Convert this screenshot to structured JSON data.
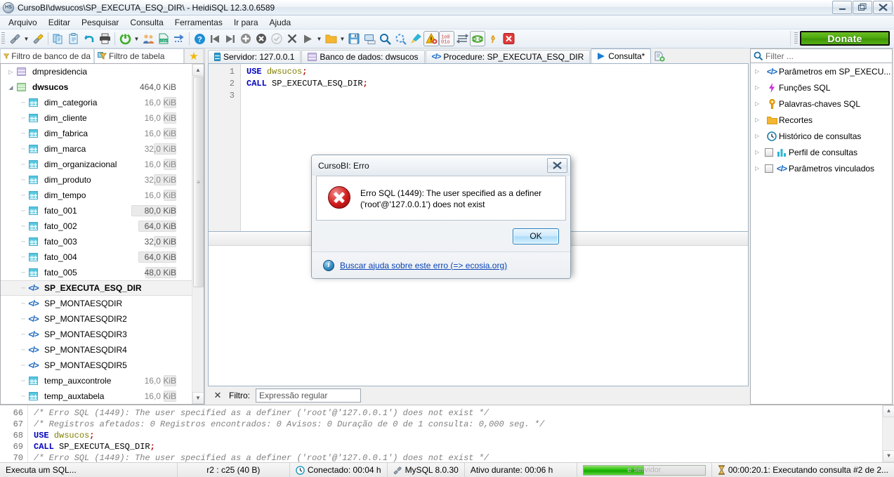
{
  "window": {
    "title": "CursoBI\\dwsucos\\SP_EXECUTA_ESQ_DIR\\ - HeidiSQL 12.3.0.6589",
    "app_icon_text": "HS",
    "minimize_label": "—",
    "maximize_label": "❐",
    "close_label": "✕"
  },
  "menubar": {
    "items": [
      {
        "label": "Arquivo"
      },
      {
        "label": "Editar"
      },
      {
        "label": "Pesquisar"
      },
      {
        "label": "Consulta"
      },
      {
        "label": "Ferramentas"
      },
      {
        "label": "Ir para"
      },
      {
        "label": "Ajuda"
      }
    ]
  },
  "toolbar": {
    "donate_label": "Donate",
    "buttons": [
      {
        "name": "new-session-icon",
        "glyph": "🔌"
      },
      {
        "name": "new-session-dropdown-icon",
        "glyph": "▾"
      },
      {
        "name": "new-session-edit-icon",
        "glyph": "🔌"
      },
      {
        "name": "copy-icon",
        "glyph": "📋"
      },
      {
        "name": "paste-icon",
        "glyph": "📋"
      },
      {
        "name": "undo-icon",
        "glyph": "↶"
      },
      {
        "name": "print-icon",
        "glyph": "🖨"
      },
      {
        "name": "refresh-icon",
        "glyph": "⟳"
      },
      {
        "name": "refresh-dropdown-icon",
        "glyph": "▾"
      },
      {
        "name": "users-icon",
        "glyph": "👥"
      },
      {
        "name": "export-csv-icon",
        "glyph": "CSV"
      },
      {
        "name": "import-icon",
        "glyph": "⇥"
      },
      {
        "name": "help-icon",
        "glyph": "?"
      },
      {
        "name": "first-row-icon",
        "glyph": "⏮"
      },
      {
        "name": "last-row-icon",
        "glyph": "⏭"
      },
      {
        "name": "insert-row-icon",
        "glyph": "+"
      },
      {
        "name": "delete-row-icon",
        "glyph": "✕"
      },
      {
        "name": "apply-changes-icon",
        "glyph": "✓"
      },
      {
        "name": "cancel-changes-icon",
        "glyph": "✕"
      },
      {
        "name": "run-query-icon",
        "glyph": "▶"
      },
      {
        "name": "run-query-dropdown-icon",
        "glyph": "▾"
      },
      {
        "name": "open-file-icon",
        "glyph": "📁"
      },
      {
        "name": "open-file-dropdown-icon",
        "glyph": "▾"
      },
      {
        "name": "save-file-icon",
        "glyph": "💾"
      },
      {
        "name": "save-as-icon",
        "glyph": "🖫"
      },
      {
        "name": "find-icon",
        "glyph": "🔍"
      },
      {
        "name": "find-replace-icon",
        "glyph": "⟳"
      },
      {
        "name": "format-sql-icon",
        "glyph": "🖌"
      },
      {
        "name": "warning-icon",
        "glyph": "⚠"
      },
      {
        "name": "binary-icon",
        "glyph": "100"
      },
      {
        "name": "wrap-lines-icon",
        "glyph": "⇶"
      },
      {
        "name": "refresh-pair-icon",
        "glyph": "↔"
      },
      {
        "name": "delimiter-icon",
        "glyph": ";"
      },
      {
        "name": "stop-icon",
        "glyph": "✕"
      }
    ]
  },
  "sidebar": {
    "db_filter_placeholder": "Filtro de banco de da",
    "table_filter_placeholder": "Filtro de tabela",
    "favorites_icon": "★",
    "tree": [
      {
        "name": "dmpresidencia",
        "type": "database",
        "size": "",
        "expander": "▷",
        "bold": false,
        "active": false
      },
      {
        "name": "dwsucos",
        "type": "database",
        "size": "464,0 KiB",
        "expander": "◢",
        "bold": true,
        "active": true
      },
      {
        "name": "dim_categoria",
        "type": "table",
        "size": "16,0 KiB",
        "bar": 18
      },
      {
        "name": "dim_cliente",
        "type": "table",
        "size": "16,0 KiB",
        "bar": 18
      },
      {
        "name": "dim_fabrica",
        "type": "table",
        "size": "16,0 KiB",
        "bar": 18
      },
      {
        "name": "dim_marca",
        "type": "table",
        "size": "32,0 KiB",
        "bar": 32
      },
      {
        "name": "dim_organizacional",
        "type": "table",
        "size": "16,0 KiB",
        "bar": 18
      },
      {
        "name": "dim_produto",
        "type": "table",
        "size": "32,0 KiB",
        "bar": 32
      },
      {
        "name": "dim_tempo",
        "type": "table",
        "size": "16,0 KiB",
        "bar": 18
      },
      {
        "name": "fato_001",
        "type": "table",
        "size": "80,0 KiB",
        "bar": 64
      },
      {
        "name": "fato_002",
        "type": "table",
        "size": "64,0 KiB",
        "bar": 54
      },
      {
        "name": "fato_003",
        "type": "table",
        "size": "32,0 KiB",
        "bar": 32
      },
      {
        "name": "fato_004",
        "type": "table",
        "size": "64,0 KiB",
        "bar": 54
      },
      {
        "name": "fato_005",
        "type": "table",
        "size": "48,0 KiB",
        "bar": 44
      },
      {
        "name": "SP_EXECUTA_ESQ_DIR",
        "type": "procedure",
        "size": "",
        "selected": true,
        "bold": true
      },
      {
        "name": "SP_MONTAESQDIR",
        "type": "procedure",
        "size": ""
      },
      {
        "name": "SP_MONTAESQDIR2",
        "type": "procedure",
        "size": ""
      },
      {
        "name": "SP_MONTAESQDIR3",
        "type": "procedure",
        "size": ""
      },
      {
        "name": "SP_MONTAESQDIR4",
        "type": "procedure",
        "size": ""
      },
      {
        "name": "SP_MONTAESQDIR5",
        "type": "procedure",
        "size": ""
      },
      {
        "name": "temp_auxcontrole",
        "type": "table",
        "size": "16,0 KiB",
        "bar": 18
      },
      {
        "name": "temp_auxtabela",
        "type": "table",
        "size": "16,0 KiB",
        "bar": 18
      }
    ]
  },
  "tabs": [
    {
      "label": "Servidor: 127.0.0.1",
      "icon": "server-icon",
      "active": false
    },
    {
      "label": "Banco de dados: dwsucos",
      "icon": "database-icon",
      "active": false
    },
    {
      "label": "Procedure: SP_EXECUTA_ESQ_DIR",
      "icon": "code-icon",
      "active": false
    },
    {
      "label": "Consulta*",
      "icon": "run-icon",
      "active": true
    }
  ],
  "tab_add_label": "＋",
  "editor": {
    "line_numbers": [
      "1",
      "2",
      "3"
    ],
    "lines": [
      {
        "tokens": [
          {
            "t": "USE",
            "c": "kw"
          },
          {
            "t": " ",
            "c": "plain"
          },
          {
            "t": "dwsucos",
            "c": "ident"
          },
          {
            "t": ";",
            "c": "punct"
          }
        ]
      },
      {
        "tokens": [
          {
            "t": "CALL",
            "c": "kw"
          },
          {
            "t": " SP_EXECUTA_ESQ_DIR",
            "c": "plain"
          },
          {
            "t": ";",
            "c": "punct"
          }
        ]
      },
      {
        "tokens": []
      }
    ]
  },
  "result_filter": {
    "close_label": "✕",
    "label": "Filtro:",
    "placeholder": "Expressão regular",
    "value": ""
  },
  "right_panel": {
    "filter_placeholder": "Filter ...",
    "search_icon": "🔍",
    "items": [
      {
        "label": "Parâmetros em SP_EXECU...",
        "icon": "code-icon",
        "expander": "▷",
        "checkbox": false
      },
      {
        "label": "Funções SQL",
        "icon": "lightning-icon",
        "expander": "▷",
        "checkbox": false
      },
      {
        "label": "Palavras-chaves SQL",
        "icon": "key-icon",
        "expander": "▷",
        "checkbox": false
      },
      {
        "label": "Recortes",
        "icon": "folder-icon",
        "expander": "▷",
        "checkbox": false
      },
      {
        "label": "Histórico de consultas",
        "icon": "clock-icon",
        "expander": "▷",
        "checkbox": false
      },
      {
        "label": "Perfil de consultas",
        "icon": "chart-icon",
        "expander": "▷",
        "checkbox": true
      },
      {
        "label": "Parâmetros vinculados",
        "icon": "code-icon",
        "expander": "▷",
        "checkbox": true
      }
    ]
  },
  "log": {
    "line_numbers": [
      "66",
      "67",
      "68",
      "69",
      "70"
    ],
    "lines": [
      {
        "style": "comment",
        "text": "/* Erro SQL (1449): The user specified as a definer ('root'@'127.0.0.1') does not exist */"
      },
      {
        "style": "comment",
        "text": "/* Registros afetados: 0  Registros encontrados: 0  Avisos: 0  Duração de 0 de 1 consulta: 0,000 seg. */"
      },
      {
        "style": "sql_use",
        "text": "USE dwsucos;"
      },
      {
        "style": "sql_call",
        "text": "CALL SP_EXECUTA_ESQ_DIR;"
      },
      {
        "style": "comment",
        "text": "/* Erro SQL (1449): The user specified as a definer ('root'@'127.0.0.1') does not exist */"
      }
    ]
  },
  "statusbar": {
    "hint": "Executa um SQL...",
    "cursor": "r2 : c25 (40 B)",
    "connected": "Conectado: 00:04 h",
    "connected_icon": "🕐",
    "server_version": "MySQL 8.0.30",
    "server_icon": "🔌",
    "uptime": "Ativo durante: 00:06 h",
    "progress_text": "e servidor",
    "progress_percent": 50,
    "task": "00:00:20.1: Executando consulta #2 de 2...",
    "task_icon": "⧗"
  },
  "dialog": {
    "title": "CursoBI: Erro",
    "close_label": "✕",
    "message_line1": "Erro SQL (1449): The user specified as a definer",
    "message_line2": "('root'@'127.0.0.1') does not exist",
    "ok_label": "OK",
    "help_link": "Buscar ajuda sobre este erro (=> ecosia.org)",
    "error_icon": "error-icon",
    "info_icon": "i"
  },
  "colors": {
    "accent_blue": "#0a44b4",
    "error_red": "#d31b1b",
    "donate_green": "#4da80d",
    "keyword_blue": "#0000c0",
    "identifier_olive": "#808000",
    "comment_gray": "#808080"
  }
}
